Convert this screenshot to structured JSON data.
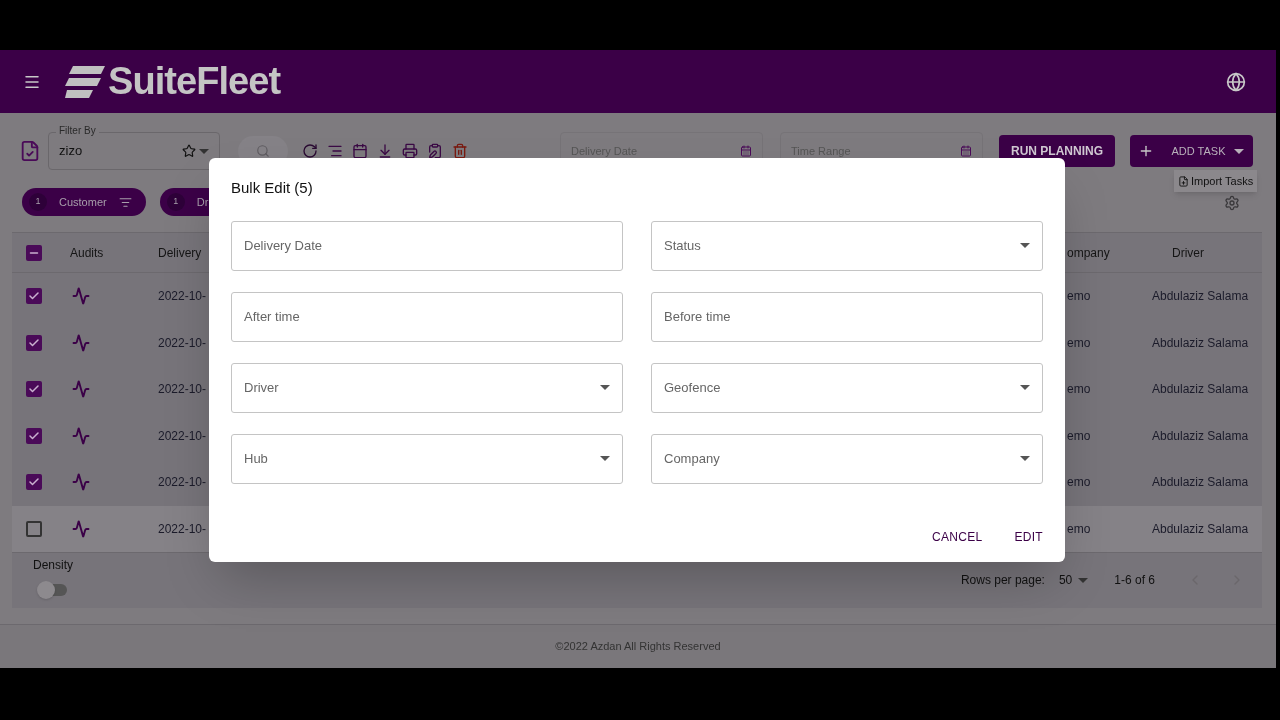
{
  "header": {
    "brand": "SuiteFleet"
  },
  "toolbar": {
    "filter_label": "Filter By",
    "filter_value": "zizo",
    "delivery_date_placeholder": "Delivery Date",
    "time_range_placeholder": "Time Range",
    "run_planning": "RUN PLANNING",
    "add_task": "ADD TASK",
    "menu_item": "Import Tasks"
  },
  "chips": [
    {
      "count": "1",
      "label": "Customer",
      "filter_icon": true
    },
    {
      "count": "1",
      "label": "Dr"
    }
  ],
  "table": {
    "select_all": {
      "checked": true,
      "indeterminate": true
    },
    "columns": [
      "Audits",
      "Delivery",
      "ompany",
      "Driver"
    ],
    "rows": [
      {
        "checked": true,
        "hovered": false,
        "date": "2022-10-",
        "company": "emo",
        "driver": "Abdulaziz Salama"
      },
      {
        "checked": true,
        "hovered": false,
        "date": "2022-10-",
        "company": "emo",
        "driver": "Abdulaziz Salama"
      },
      {
        "checked": true,
        "hovered": false,
        "date": "2022-10-",
        "company": "emo",
        "driver": "Abdulaziz Salama"
      },
      {
        "checked": true,
        "hovered": false,
        "date": "2022-10-",
        "company": "emo",
        "driver": "Abdulaziz Salama"
      },
      {
        "checked": true,
        "hovered": false,
        "date": "2022-10-",
        "company": "emo",
        "driver": "Abdulaziz Salama"
      },
      {
        "checked": false,
        "hovered": true,
        "date": "2022-10-",
        "company": "emo",
        "driver": "Abdulaziz Salama"
      }
    ]
  },
  "footer": {
    "density_label": "Density",
    "density_on": false,
    "rows_per_page_label": "Rows per page:",
    "rows_per_page": "50",
    "range": "1-6 of 6"
  },
  "copyright": "©2022 Azdan All Rights Reserved",
  "dialog": {
    "title": "Bulk Edit (5)",
    "fields": [
      {
        "label": "Delivery Date",
        "kind": "text"
      },
      {
        "label": "Status",
        "kind": "select"
      },
      {
        "label": "After time",
        "kind": "text"
      },
      {
        "label": "Before time",
        "kind": "text"
      },
      {
        "label": "Driver",
        "kind": "select"
      },
      {
        "label": "Geofence",
        "kind": "select"
      },
      {
        "label": "Hub",
        "kind": "select"
      },
      {
        "label": "Company",
        "kind": "select"
      }
    ],
    "buttons": [
      "CANCEL",
      "EDIT"
    ]
  }
}
